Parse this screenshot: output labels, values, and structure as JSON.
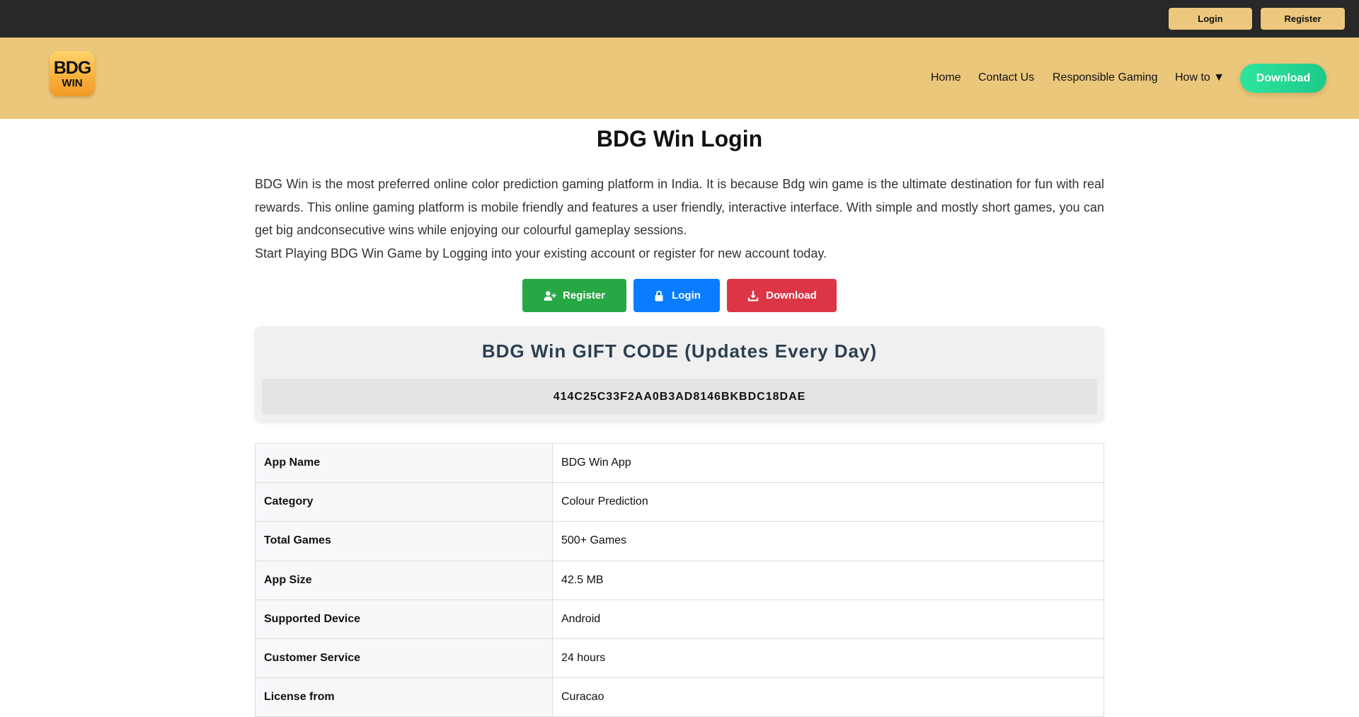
{
  "topbar": {
    "login_label": "Login",
    "register_label": "Register",
    "background": "#282828",
    "button_color": "#ecc77e"
  },
  "header": {
    "logo_line1": "BDG",
    "logo_line2": "WIN",
    "background": "#ebc77b",
    "nav": {
      "home": "Home",
      "contact": "Contact Us",
      "responsible": "Responsible Gaming",
      "howto": "How to ▼",
      "download": "Download"
    }
  },
  "main": {
    "title": "BDG Win Login",
    "intro_paragraph": "BDG Win is the most preferred online color prediction gaming platform in India. It is because Bdg win game is the ultimate destination for fun with real rewards. This online gaming platform is mobile friendly and features a user friendly, interactive interface. With simple and mostly short games, you can get big andconsecutive wins while enjoying our colourful gameplay sessions.",
    "intro_line2": "Start Playing BDG Win Game by Logging into your existing account or register for new account today.",
    "buttons": {
      "register": "Register",
      "login": "Login",
      "download": "Download",
      "register_icon": "user-plus-icon",
      "login_icon": "lock-icon",
      "download_icon": "download-icon",
      "register_color": "#28a745",
      "login_color": "#0a7cff",
      "download_color": "#dc3545"
    },
    "gift": {
      "title": "BDG Win GIFT CODE (Updates Every Day)",
      "code": "414C25C33F2AA0B3AD8146BKBDC18DAE"
    },
    "table": [
      {
        "key": "App Name",
        "value": "BDG Win App"
      },
      {
        "key": "Category",
        "value": "Colour Prediction"
      },
      {
        "key": "Total Games",
        "value": "500+ Games"
      },
      {
        "key": "App Size",
        "value": "42.5 MB"
      },
      {
        "key": "Supported Device",
        "value": "Android"
      },
      {
        "key": "Customer Service",
        "value": "24 hours"
      },
      {
        "key": "License from",
        "value": "Curacao"
      }
    ]
  }
}
